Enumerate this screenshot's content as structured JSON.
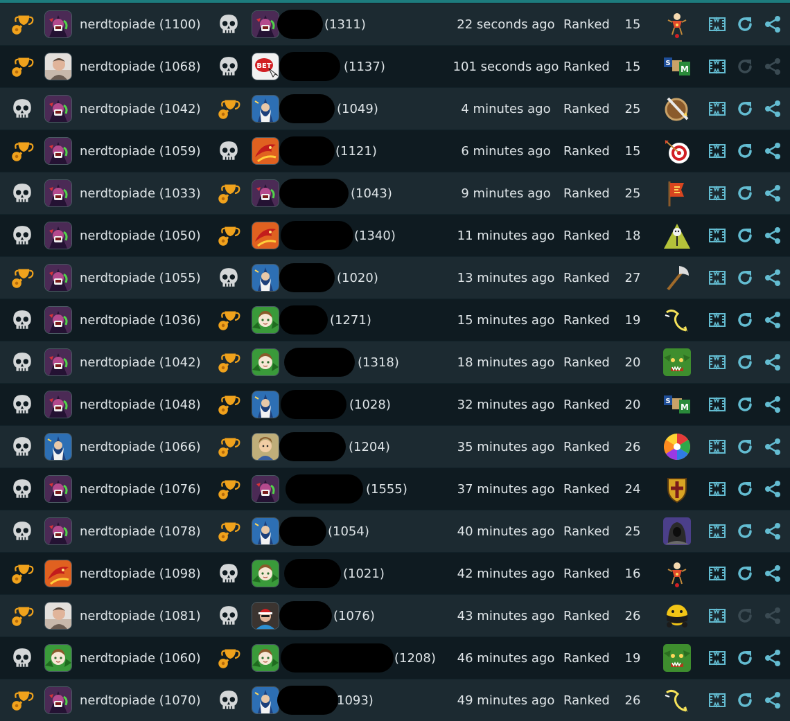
{
  "colors": {
    "row_odd": "#1c2a31",
    "row_even": "#0f1b21",
    "text": "#dfe5e8",
    "action_active": "#63bcd1",
    "action_disabled": "#3a4a52",
    "trophy": "#f0a21c",
    "skull": "#d4d7d8",
    "accent_top": "#1d7c7e"
  },
  "icons": {
    "win": "trophy-icon",
    "loss": "skull-icon",
    "replay": "replay-film-icon",
    "rematch": "rematch-icon",
    "share": "share-icon"
  },
  "matches": [
    {
      "p1_result": "win",
      "p1_avatar": "dark-wizard",
      "p1_label": "nerdtopiade (1100)",
      "p2_result": "loss",
      "p2_avatar": "dark-wizard",
      "p2_elo": "(1311)",
      "time": "22 seconds ago",
      "type": "Ranked",
      "turns": "15",
      "game_icon": "puppet",
      "rematch_enabled": true
    },
    {
      "p1_result": "win",
      "p1_avatar": "photo-man",
      "p1_label": "nerdtopiade (1068)",
      "p2_result": "loss",
      "p2_avatar": "bet-button",
      "p2_elo": "(1137)",
      "time": "101 seconds ago",
      "type": "Ranked",
      "turns": "15",
      "game_icon": "sm-tiles",
      "rematch_enabled": false
    },
    {
      "p1_result": "loss",
      "p1_avatar": "dark-wizard",
      "p1_label": "nerdtopiade (1042)",
      "p2_result": "win",
      "p2_avatar": "blue-wizard",
      "p2_elo": "(1049)",
      "time": "4 minutes ago",
      "type": "Ranked",
      "turns": "25",
      "game_icon": "shield-sword",
      "rematch_enabled": true
    },
    {
      "p1_result": "win",
      "p1_avatar": "dark-wizard",
      "p1_label": "nerdtopiade (1059)",
      "p2_result": "loss",
      "p2_avatar": "red-dragon",
      "p2_elo": "(1121)",
      "time": "6 minutes ago",
      "type": "Ranked",
      "turns": "15",
      "game_icon": "target",
      "rematch_enabled": true
    },
    {
      "p1_result": "loss",
      "p1_avatar": "dark-wizard",
      "p1_label": "nerdtopiade (1033)",
      "p2_result": "win",
      "p2_avatar": "dark-wizard",
      "p2_elo": "(1043)",
      "time": "9 minutes ago",
      "type": "Ranked",
      "turns": "25",
      "game_icon": "banner",
      "rematch_enabled": true
    },
    {
      "p1_result": "loss",
      "p1_avatar": "dark-wizard",
      "p1_label": "nerdtopiade (1050)",
      "p2_result": "win",
      "p2_avatar": "red-dragon",
      "p2_elo": "(1340)",
      "time": "11 minutes ago",
      "type": "Ranked",
      "turns": "18",
      "game_icon": "mountain",
      "rematch_enabled": true
    },
    {
      "p1_result": "win",
      "p1_avatar": "dark-wizard",
      "p1_label": "nerdtopiade (1055)",
      "p2_result": "loss",
      "p2_avatar": "blue-wizard",
      "p2_elo": "(1020)",
      "time": "13 minutes ago",
      "type": "Ranked",
      "turns": "27",
      "game_icon": "axe",
      "rematch_enabled": true
    },
    {
      "p1_result": "loss",
      "p1_avatar": "dark-wizard",
      "p1_label": "nerdtopiade (1036)",
      "p2_result": "win",
      "p2_avatar": "elf-girl",
      "p2_elo": "(1271)",
      "time": "15 minutes ago",
      "type": "Ranked",
      "turns": "19",
      "game_icon": "lightning",
      "rematch_enabled": true
    },
    {
      "p1_result": "loss",
      "p1_avatar": "dark-wizard",
      "p1_label": "nerdtopiade (1042)",
      "p2_result": "win",
      "p2_avatar": "elf-girl",
      "p2_elo": "(1318)",
      "time": "18 minutes ago",
      "type": "Ranked",
      "turns": "20",
      "game_icon": "goblin",
      "rematch_enabled": true
    },
    {
      "p1_result": "loss",
      "p1_avatar": "dark-wizard",
      "p1_label": "nerdtopiade (1048)",
      "p2_result": "win",
      "p2_avatar": "blue-wizard",
      "p2_elo": "(1028)",
      "time": "32 minutes ago",
      "type": "Ranked",
      "turns": "20",
      "game_icon": "sm-tiles",
      "rematch_enabled": true
    },
    {
      "p1_result": "loss",
      "p1_avatar": "blue-wizard",
      "p1_label": "nerdtopiade (1066)",
      "p2_result": "win",
      "p2_avatar": "cartoon-man",
      "p2_elo": "(1204)",
      "time": "35 minutes ago",
      "type": "Ranked",
      "turns": "26",
      "game_icon": "color-wheel",
      "rematch_enabled": true
    },
    {
      "p1_result": "loss",
      "p1_avatar": "dark-wizard",
      "p1_label": "nerdtopiade (1076)",
      "p2_result": "win",
      "p2_avatar": "dark-wizard",
      "p2_elo": "(1555)",
      "time": "37 minutes ago",
      "type": "Ranked",
      "turns": "24",
      "game_icon": "crest-shield",
      "rematch_enabled": true
    },
    {
      "p1_result": "loss",
      "p1_avatar": "dark-wizard",
      "p1_label": "nerdtopiade (1078)",
      "p2_result": "win",
      "p2_avatar": "blue-wizard",
      "p2_elo": "(1054)",
      "time": "40 minutes ago",
      "type": "Ranked",
      "turns": "25",
      "game_icon": "hooded-figure",
      "rematch_enabled": true
    },
    {
      "p1_result": "win",
      "p1_avatar": "red-dragon",
      "p1_label": "nerdtopiade (1098)",
      "p2_result": "loss",
      "p2_avatar": "elf-girl",
      "p2_elo": "(1021)",
      "time": "42 minutes ago",
      "type": "Ranked",
      "turns": "16",
      "game_icon": "puppet",
      "rematch_enabled": true
    },
    {
      "p1_result": "win",
      "p1_avatar": "photo-man",
      "p1_label": "nerdtopiade (1081)",
      "p2_result": "loss",
      "p2_avatar": "santa-photo",
      "p2_elo": "(1076)",
      "time": "43 minutes ago",
      "type": "Ranked",
      "turns": "26",
      "game_icon": "smiley-shadow",
      "rematch_enabled": false
    },
    {
      "p1_result": "loss",
      "p1_avatar": "elf-girl",
      "p1_label": "nerdtopiade (1060)",
      "p2_result": "win",
      "p2_avatar": "elf-girl",
      "p2_elo": "(1208)",
      "time": "46 minutes ago",
      "type": "Ranked",
      "turns": "19",
      "game_icon": "goblin",
      "rematch_enabled": true
    },
    {
      "p1_result": "win",
      "p1_avatar": "dark-wizard",
      "p1_label": "nerdtopiade (1070)",
      "p2_result": "loss",
      "p2_avatar": "blue-wizard",
      "p2_elo": "1093)",
      "time": "49 minutes ago",
      "type": "Ranked",
      "turns": "26",
      "game_icon": "lightning",
      "rematch_enabled": true
    }
  ]
}
